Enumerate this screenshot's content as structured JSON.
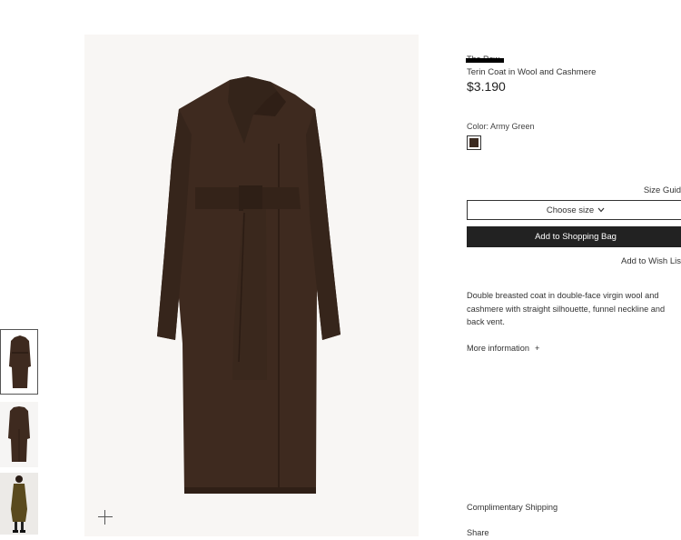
{
  "product": {
    "brand": "The Row",
    "name": "Terin Coat in Wool and Cashmere",
    "price": "$3.190",
    "color_label": "Color: Army Green",
    "swatch_color": "#3b2a20",
    "size_guide_label": "Size Guid",
    "size_select_label": "Choose size",
    "add_to_bag_label": "Add to Shopping Bag",
    "wish_list_label": "Add to Wish Lis",
    "description": "Double breasted coat in double-face virgin wool and cashmere with straight silhouette, funnel neckline and back vent.",
    "more_info_label": "More information",
    "more_info_icon": "+",
    "shipping_label": "Complimentary Shipping",
    "share_label": "Share"
  },
  "colors": {
    "coat": "#3e2a1f",
    "coat_shadow": "#2f1f16",
    "image_bg": "#f8f6f4",
    "button_bg": "#222222"
  },
  "icons": {
    "zoom": "plus-icon",
    "chevron": "chevron-down-icon"
  }
}
